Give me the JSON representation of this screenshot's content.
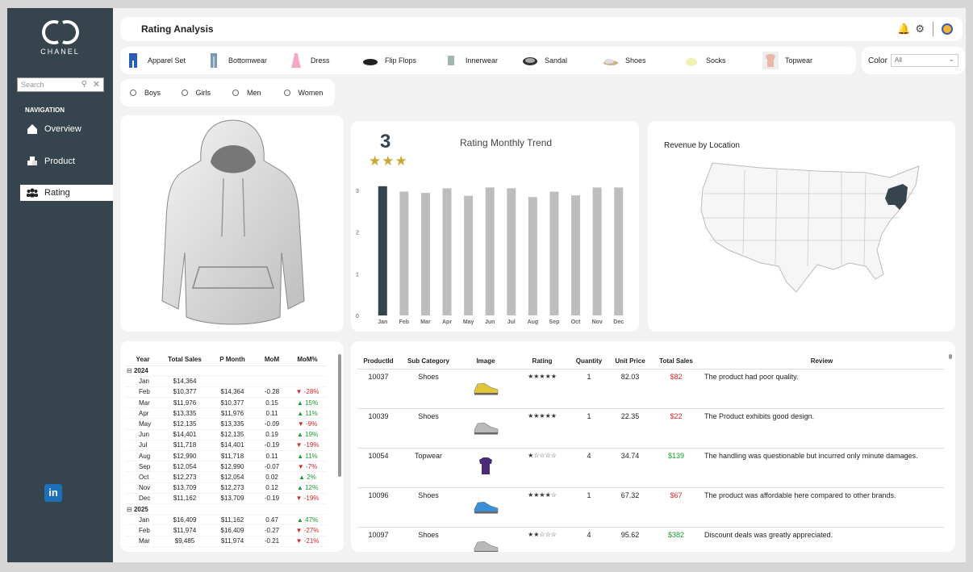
{
  "brand": {
    "name": "CHANEL"
  },
  "sidebar": {
    "search_placeholder": "Search",
    "nav_header": "NAVIGATION",
    "items": [
      {
        "label": "Overview",
        "icon": "home-icon"
      },
      {
        "label": "Product",
        "icon": "boxes-icon"
      },
      {
        "label": "Rating",
        "icon": "people-icon",
        "active": true
      }
    ],
    "footer_icon": "linkedin-icon"
  },
  "header": {
    "title": "Rating Analysis",
    "icons": [
      "notification-settings-icon",
      "gear-icon",
      "avatar"
    ]
  },
  "categories": [
    "Apparel Set",
    "Bottomwear",
    "Dress",
    "Flip Flops",
    "Innerwear",
    "Sandal",
    "Shoes",
    "Socks",
    "Topwear"
  ],
  "color_filter": {
    "label": "Color",
    "value": "All"
  },
  "gender_filter": [
    "Boys",
    "Girls",
    "Men",
    "Women"
  ],
  "trend_card": {
    "value": "3",
    "stars": "★★★",
    "title": "Rating Monthly Trend"
  },
  "chart_data": {
    "type": "bar",
    "title": "Rating Monthly Trend",
    "categories": [
      "Jan",
      "Feb",
      "Mar",
      "Apr",
      "May",
      "Jun",
      "Jul",
      "Aug",
      "Sep",
      "Oct",
      "Nov",
      "Dec"
    ],
    "values": [
      3.1,
      2.97,
      2.94,
      3.05,
      2.87,
      3.07,
      3.05,
      2.84,
      2.97,
      2.88,
      3.07,
      3.07
    ],
    "highlight_index": 0,
    "ylim": [
      0,
      3
    ],
    "yticks": [
      "0",
      "1",
      "2",
      "3"
    ],
    "colors": {
      "highlight": "#36444d",
      "default": "#bdbdbd"
    }
  },
  "map_card": {
    "title": "Revenue by Location",
    "highlight_state": "New York",
    "highlight_color": "#36444d"
  },
  "monthly_table": {
    "headers": [
      "Year",
      "Total Sales",
      "P Month",
      "MoM",
      "MoM%"
    ],
    "groups": [
      {
        "year": "2024",
        "rows": [
          [
            "Jan",
            "$14,364",
            "",
            "",
            ""
          ],
          [
            "Feb",
            "$10,377",
            "$14,364",
            "-0.28",
            "▼ -28%"
          ],
          [
            "Mar",
            "$11,976",
            "$10,377",
            "0.15",
            "▲ 15%"
          ],
          [
            "Apr",
            "$13,335",
            "$11,976",
            "0.11",
            "▲ 11%"
          ],
          [
            "May",
            "$12,135",
            "$13,335",
            "-0.09",
            "▼ -9%"
          ],
          [
            "Jun",
            "$14,401",
            "$12,135",
            "0.19",
            "▲ 19%"
          ],
          [
            "Jul",
            "$11,718",
            "$14,401",
            "-0.19",
            "▼ -19%"
          ],
          [
            "Aug",
            "$12,990",
            "$11,718",
            "0.11",
            "▲ 11%"
          ],
          [
            "Sep",
            "$12,054",
            "$12,990",
            "-0.07",
            "▼ -7%"
          ],
          [
            "Oct",
            "$12,273",
            "$12,054",
            "0.02",
            "▲ 2%"
          ],
          [
            "Nov",
            "$13,709",
            "$12,273",
            "0.12",
            "▲ 12%"
          ],
          [
            "Dec",
            "$11,162",
            "$13,709",
            "-0.19",
            "▼ -19%"
          ]
        ]
      },
      {
        "year": "2025",
        "rows": [
          [
            "Jan",
            "$16,409",
            "$11,162",
            "0.47",
            "▲ 47%"
          ],
          [
            "Feb",
            "$11,974",
            "$16,409",
            "-0.27",
            "▼ -27%"
          ],
          [
            "Mar",
            "$9,485",
            "$11,974",
            "-0.21",
            "▼ -21%"
          ]
        ]
      }
    ]
  },
  "detail_table": {
    "headers": [
      "ProductId",
      "Sub Category",
      "Image",
      "Rating",
      "Quantity",
      "Unit Price",
      "Total Sales",
      "Review"
    ],
    "rows": [
      {
        "id": "10037",
        "sub": "Shoes",
        "image": "running-shoe-yellow",
        "rating": "★★★★★",
        "qty": "1",
        "price": "82.03",
        "total": "$82",
        "total_color": "#d6262b",
        "review": "The product had poor quality."
      },
      {
        "id": "10039",
        "sub": "Shoes",
        "image": "running-shoe-grey",
        "rating": "★★★★★",
        "qty": "1",
        "price": "22.35",
        "total": "$22",
        "total_color": "#d6262b",
        "review": "The Product exhibits good design."
      },
      {
        "id": "10054",
        "sub": "Topwear",
        "image": "purple-tshirt",
        "rating": "★☆☆☆☆",
        "qty": "4",
        "price": "34.74",
        "total": "$139",
        "total_color": "#1a9c2a",
        "review": "The handling was questionable but incurred only minute damages."
      },
      {
        "id": "10096",
        "sub": "Shoes",
        "image": "running-shoe-blue",
        "rating": "★★★★☆",
        "qty": "1",
        "price": "67.32",
        "total": "$67",
        "total_color": "#d6262b",
        "review": "The product was affordable here compared to other brands."
      },
      {
        "id": "10097",
        "sub": "Shoes",
        "image": "running-shoe-grey",
        "rating": "★★☆☆☆",
        "qty": "4",
        "price": "95.62",
        "total": "$382",
        "total_color": "#1a9c2a",
        "review": "Discount deals was greatly appreciated."
      }
    ]
  }
}
